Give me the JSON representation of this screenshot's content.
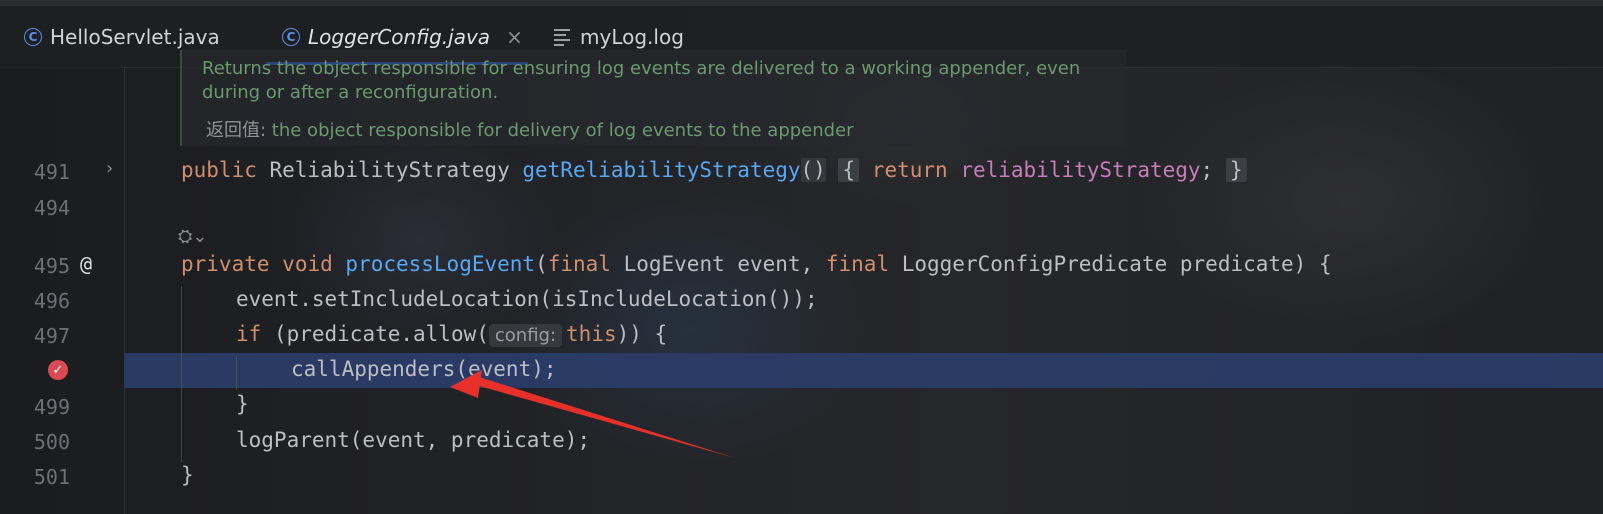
{
  "tabs": [
    {
      "label": "HelloServlet.java",
      "icon": "class-c-icon"
    },
    {
      "label": "LoggerConfig.java",
      "icon": "class-c-icon",
      "active": true,
      "close": "×"
    },
    {
      "label": "myLog.log",
      "icon": "text-file-icon"
    }
  ],
  "doc": {
    "line1": "Returns the object responsible for ensuring log events are delivered to a working appender, even",
    "line2": "during or after a reconfiguration.",
    "returns_label": "返回值:",
    "returns_text": " the object responsible for delivery of log events to the appender"
  },
  "gutter": {
    "line_numbers": [
      "491",
      "494",
      "495",
      "496",
      "497",
      "499",
      "500",
      "501"
    ],
    "fold_glyph": "›",
    "at_glyph": "@",
    "breakpoint_glyph": "✓"
  },
  "code": {
    "l491": {
      "kw1": "public",
      "type": " ReliabilityStrategy ",
      "fn": "getReliabilityStrategy",
      "paren": "()",
      "brace_open": "{",
      "kw2": "return",
      "field": "reliabilityStrategy",
      "semi": ";",
      "brace_close": "}"
    },
    "l495": {
      "kw1": "private",
      "kw2": "void",
      "fn": "processLogEvent",
      "p1": "(",
      "kw3": "final",
      "t1": " LogEvent event, ",
      "kw4": "final",
      "t2": " LoggerConfigPredicate predicate) {"
    },
    "l496": "event.setIncludeLocation(isIncludeLocation());",
    "l497": {
      "kw": "if",
      "t1": " (predicate.allow(",
      "hint": "config:",
      "kw2": "this",
      "t2": ")) {"
    },
    "l498": "callAppenders(event);",
    "l499": "}",
    "l500": "logParent(event, predicate);",
    "l501": "}"
  },
  "colors": {
    "keyword": "#cf8e6d",
    "function": "#56a8f5",
    "field": "#c77dbb",
    "execution_line": "#2b3d69",
    "arrow": "#e8302a",
    "breakpoint": "#d94a54"
  }
}
